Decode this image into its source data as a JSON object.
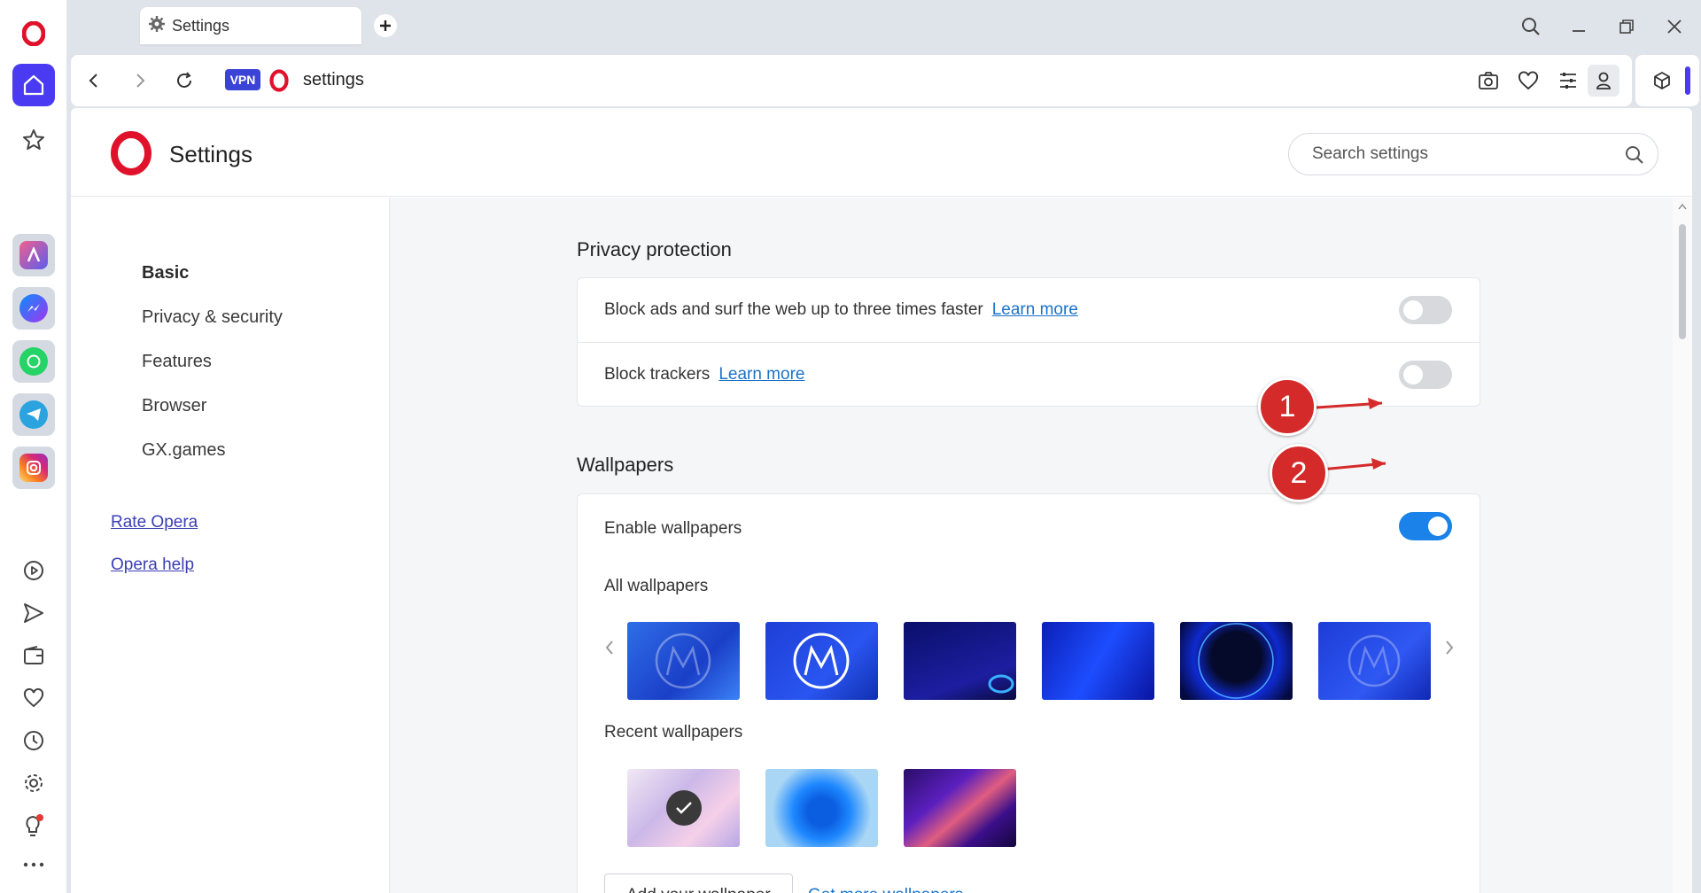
{
  "tab": {
    "title": "Settings"
  },
  "address_bar": {
    "vpn_label": "VPN",
    "url": "settings"
  },
  "page": {
    "title": "Settings",
    "search_placeholder": "Search settings"
  },
  "nav": {
    "items": [
      {
        "label": "Basic",
        "active": true
      },
      {
        "label": "Privacy & security",
        "active": false
      },
      {
        "label": "Features",
        "active": false
      },
      {
        "label": "Browser",
        "active": false
      },
      {
        "label": "GX.games",
        "active": false
      }
    ],
    "links": [
      "Rate Opera",
      "Opera help"
    ]
  },
  "privacy": {
    "title": "Privacy protection",
    "rows": [
      {
        "text": "Block ads and surf the web up to three times faster",
        "link": "Learn more",
        "enabled": false
      },
      {
        "text": "Block trackers",
        "link": "Learn more",
        "enabled": false
      }
    ]
  },
  "wallpapers": {
    "title": "Wallpapers",
    "enable_label": "Enable wallpapers",
    "enabled": true,
    "all_label": "All wallpapers",
    "recent_label": "Recent wallpapers",
    "add_button": "Add your wallpaper",
    "more_link": "Get more wallpapers"
  },
  "annotations": [
    "1",
    "2"
  ],
  "colors": {
    "accent": "#4a3bf2",
    "toggle_on": "#1a82e8",
    "link": "#1a73c8",
    "annotation": "#d42a2a",
    "opera_red": "#e0122b"
  },
  "sidebar_icons": [
    "opera-logo-icon",
    "home-icon",
    "star-icon",
    "aria-icon",
    "messenger-icon",
    "whatsapp-icon",
    "telegram-icon",
    "instagram-icon",
    "player-icon",
    "send-icon",
    "wallet-icon",
    "heart-icon",
    "history-icon",
    "gear-icon",
    "lightbulb-icon",
    "more-icon"
  ]
}
